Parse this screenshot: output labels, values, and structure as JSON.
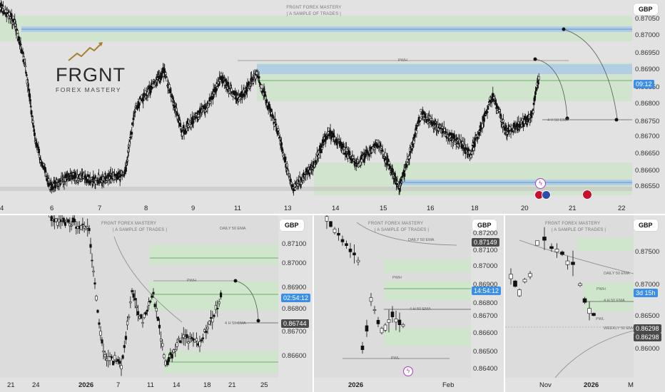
{
  "brand": {
    "logo_text": "FRGNT",
    "logo_sub": "FOREX MASTERY",
    "watermark_title": "FRGNT FOREX MASTERY",
    "watermark_sub": "|  A SAMPLE OF TRADES  |"
  },
  "colors": {
    "bg": "#e2e2e2",
    "green_zone": "#cfe6cc",
    "blue_band": "#a9c8e8",
    "candle": "#111111",
    "accent_blue": "#3a8ee6"
  },
  "top": {
    "currency": "GBP",
    "price_tag": "09:12",
    "y_labels": [
      "0.87050",
      "0.87000",
      "0.86950",
      "0.86900",
      "0.86850",
      "0.86800",
      "0.86750",
      "0.86700",
      "0.86650",
      "0.86600",
      "0.86550"
    ],
    "x_labels": [
      "4",
      "6",
      "7",
      "8",
      "9",
      "11",
      "13",
      "14",
      "15",
      "16",
      "18",
      "20",
      "21",
      "22"
    ],
    "annotations": {
      "pwh": "PWH",
      "ema": "4 H 50 EMA"
    }
  },
  "bottom_left": {
    "currency": "GBP",
    "price_tag": "02:54:12",
    "price_tag2": "0.86744",
    "y_labels": [
      "0.87100",
      "0.87000",
      "0.86900",
      "0.86800",
      "0.86700",
      "0.86600"
    ],
    "x_labels": [
      "21",
      "24",
      "2026",
      "7",
      "11",
      "14",
      "18",
      "21",
      "25"
    ],
    "annotations": {
      "daily_ema": "DAILY 50 EMA",
      "pwh": "PWH",
      "ema": "4 H 50 EMA"
    }
  },
  "bottom_mid": {
    "currency": "GBP",
    "price_tag": "14:54:12",
    "price_tag2": "0.87149",
    "y_labels": [
      "0.87200",
      "0.87100",
      "0.87000",
      "0.86900",
      "0.86800",
      "0.86700",
      "0.86600",
      "0.86500",
      "0.86400"
    ],
    "x_labels": [
      "2026",
      "Feb"
    ],
    "annotations": {
      "daily_ema": "DAILY 50 EMA",
      "pwh": "PWH",
      "ema": "4 H 50 EMA",
      "pwl": "PWL"
    }
  },
  "bottom_right": {
    "currency": "GBP",
    "price_tag": "3d 15h",
    "price_tag2": "0.86298",
    "price_tag3": "0.86298",
    "y_labels": [
      "0.87500",
      "0.87000",
      "0.86500",
      "0.86000"
    ],
    "x_labels": [
      "Nov",
      "2026",
      "M"
    ],
    "annotations": {
      "daily_ema": "DAILY 50 EMA",
      "weekly_ema": "WEEKLY 50 EMA",
      "pwh": "PWH",
      "ema": "4 H 50 EMA",
      "pwl": "PWL"
    }
  }
}
